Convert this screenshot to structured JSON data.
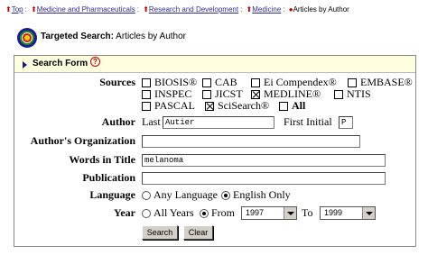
{
  "breadcrumb": {
    "items": [
      {
        "label": "Top",
        "link": true
      },
      {
        "label": "Medicine and Pharmaceuticals",
        "link": true
      },
      {
        "label": "Research and Development",
        "link": true
      },
      {
        "label": "Medicine",
        "link": true
      },
      {
        "label": "Articles by Author",
        "link": false
      }
    ],
    "separator": ":"
  },
  "header": {
    "title_bold": "Targeted Search:",
    "title_rest": " Articles by Author"
  },
  "search_form": {
    "label": "Search Form",
    "help_glyph": "?"
  },
  "form": {
    "sources_label": "Sources",
    "sources": [
      {
        "label": "BIOSIS®",
        "checked": false
      },
      {
        "label": "CAB",
        "checked": false
      },
      {
        "label": "Ei Compendex®",
        "checked": false
      },
      {
        "label": "EMBASE®",
        "checked": false
      },
      {
        "label": "INSPEC",
        "checked": false
      },
      {
        "label": "JICST",
        "checked": false
      },
      {
        "label": "MEDLINE®",
        "checked": true
      },
      {
        "label": "NTIS",
        "checked": false
      },
      {
        "label": "PASCAL",
        "checked": false
      },
      {
        "label": "SciSearch®",
        "checked": true
      },
      {
        "label": "All",
        "checked": false
      }
    ],
    "author_label": "Author",
    "last_label": "Last",
    "last_value": "Autier",
    "first_initial_label": "First Initial",
    "first_initial_value": "P",
    "org_label": "Author's Organization",
    "org_value": "",
    "title_words_label": "Words in Title",
    "title_words_value": "melanoma",
    "publication_label": "Publication",
    "publication_value": "",
    "language_label": "Language",
    "language_any": "Any Language",
    "language_english": "English Only",
    "language_selected": "english",
    "year_label": "Year",
    "year_all": "All Years",
    "year_from": "From",
    "year_from_value": "1997",
    "year_to": "To",
    "year_to_value": "1999",
    "year_selected": "from"
  },
  "buttons": {
    "search": "Search",
    "clear": "Clear"
  },
  "colors": {
    "link": "#2b2b9f",
    "arrow_red": "#c00000",
    "bar_bg": "#ffffe0"
  }
}
